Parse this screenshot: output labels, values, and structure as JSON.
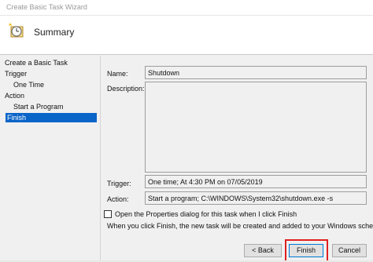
{
  "window": {
    "title": "Create Basic Task Wizard"
  },
  "header": {
    "title": "Summary",
    "icon": "task-clock-icon"
  },
  "sidebar": {
    "items": [
      {
        "label": "Create a Basic Task"
      },
      {
        "label": "Trigger"
      },
      {
        "label": "One Time"
      },
      {
        "label": "Action"
      },
      {
        "label": "Start a Program"
      },
      {
        "label": "Finish"
      }
    ],
    "selected": "Finish",
    "selected_color": "#0a65c8"
  },
  "form": {
    "name_label": "Name:",
    "name_value": "Shutdown",
    "description_label": "Description:",
    "description_value": "",
    "trigger_label": "Trigger:",
    "trigger_value": "One time; At 4:30 PM on 07/05/2019",
    "action_label": "Action:",
    "action_value": "Start a program; C:\\WINDOWS\\System32\\shutdown.exe -s"
  },
  "options": {
    "open_properties_label": "Open the Properties dialog for this task when I click Finish",
    "open_properties_checked": false,
    "note": "When you click Finish, the new task will be created and added to your Windows schedule."
  },
  "buttons": {
    "back": "< Back",
    "finish": "Finish",
    "cancel": "Cancel"
  },
  "highlight_color": "#e02020"
}
